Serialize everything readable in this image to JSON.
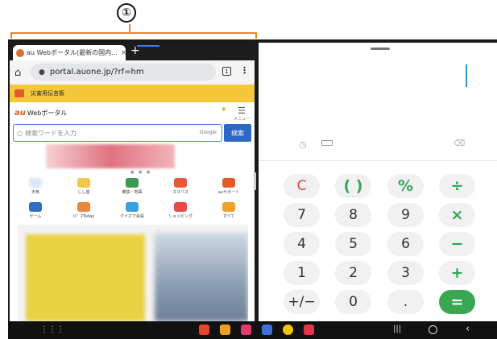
{
  "annotation": {
    "callout": "①",
    "bracket_color": "#e8862a"
  },
  "browser": {
    "tab_title": "au Webポータル(最新の国内...",
    "tab_close": "×",
    "new_tab": "+",
    "url": "portal.auone.jp/?rf=hm",
    "tab_count": "1",
    "banner_text": "災害用伝言板",
    "portal_logo": "au",
    "portal_name": "Webポータル",
    "portal_icon_labels": [
      "メニュー"
    ],
    "search_placeholder": "検索ワードを入力",
    "search_engine_mark": "Google",
    "search_button": "検索",
    "shortcuts": [
      {
        "label": "天気",
        "icon": "weather-icon",
        "color": "#d9e7f6"
      },
      {
        "label": "しし座",
        "icon": "horoscope-icon",
        "color": "#f4c74a"
      },
      {
        "label": "乗換・地図",
        "icon": "train-icon",
        "color": "#3a9a54"
      },
      {
        "label": "スマパス",
        "icon": "smartpass-icon",
        "color": "#e8593b"
      },
      {
        "label": "auサポート",
        "icon": "support-icon",
        "color": "#e35a2b"
      },
      {
        "label": "ゲーム",
        "icon": "game-icon",
        "color": "#2f6fbf"
      },
      {
        "label": "ﾄﾋﾟ 2Today",
        "icon": "topics-icon",
        "color": "#e8863a"
      },
      {
        "label": "クイズで会員",
        "icon": "quiz-icon",
        "color": "#3aa0e0"
      },
      {
        "label": "ショッピング",
        "icon": "shopping-icon",
        "color": "#e84a4a"
      },
      {
        "label": "すべて",
        "icon": "all-icon",
        "color": "#f0a030"
      }
    ]
  },
  "calculator": {
    "keys": [
      {
        "label": "C",
        "type": "clear"
      },
      {
        "label": "( )",
        "type": "op"
      },
      {
        "label": "%",
        "type": "op"
      },
      {
        "label": "÷",
        "type": "op"
      },
      {
        "label": "7",
        "type": "num"
      },
      {
        "label": "8",
        "type": "num"
      },
      {
        "label": "9",
        "type": "num"
      },
      {
        "label": "×",
        "type": "op"
      },
      {
        "label": "4",
        "type": "num"
      },
      {
        "label": "5",
        "type": "num"
      },
      {
        "label": "6",
        "type": "num"
      },
      {
        "label": "−",
        "type": "op"
      },
      {
        "label": "1",
        "type": "num"
      },
      {
        "label": "2",
        "type": "num"
      },
      {
        "label": "3",
        "type": "num"
      },
      {
        "label": "+",
        "type": "op"
      },
      {
        "label": "+/−",
        "type": "num"
      },
      {
        "label": "0",
        "type": "num"
      },
      {
        "label": ".",
        "type": "num"
      },
      {
        "label": "=",
        "type": "eq"
      }
    ],
    "accent": "#39a653"
  },
  "navbar": {
    "dock_apps": [
      {
        "name": "app-red-icon",
        "color": "#e8452f"
      },
      {
        "name": "app-orange-icon",
        "color": "#f0a020"
      },
      {
        "name": "app-pink-icon",
        "color": "#e03a6a"
      },
      {
        "name": "app-blue-icon",
        "color": "#3f6fd8"
      },
      {
        "name": "chrome-icon",
        "color": "#f5c400"
      },
      {
        "name": "camera-icon",
        "color": "#e8344a"
      }
    ]
  }
}
